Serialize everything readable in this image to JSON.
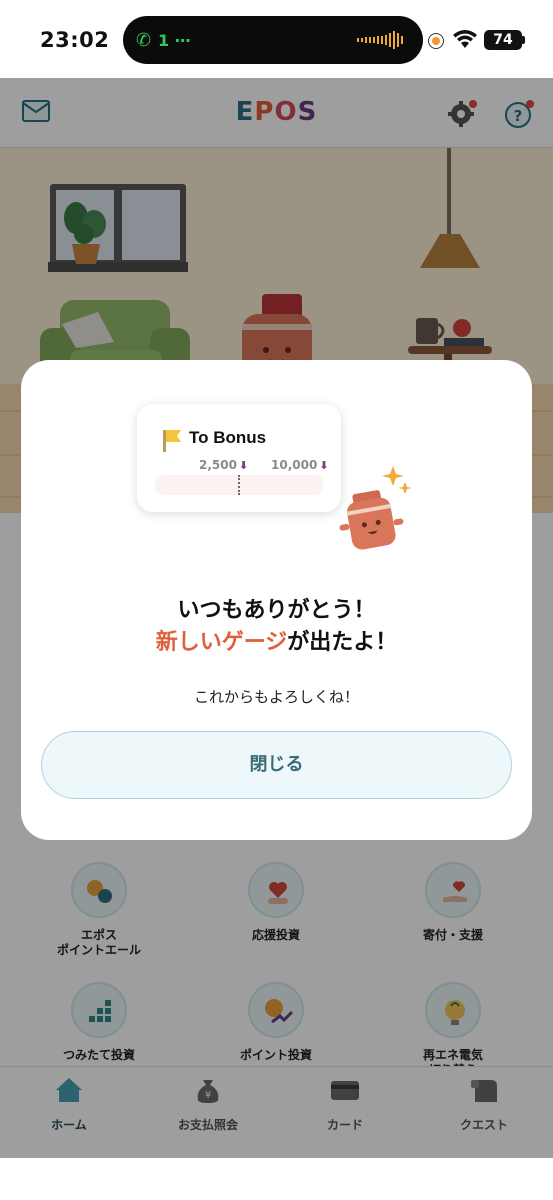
{
  "status_bar": {
    "time": "23:02",
    "call": "1 ⋯",
    "battery": "74"
  },
  "header": {
    "logo_letters": [
      {
        "char": "E",
        "color": "#2a6f86"
      },
      {
        "char": "P",
        "color": "#e0603a"
      },
      {
        "char": "O",
        "color": "#d14b5b"
      },
      {
        "char": "S",
        "color": "#6a3d7a"
      }
    ]
  },
  "features": [
    {
      "label": "エポス\nポイントエール"
    },
    {
      "label": "応援投資"
    },
    {
      "label": "寄付・支援"
    },
    {
      "label": "つみたて投資"
    },
    {
      "label": "ポイント投資"
    },
    {
      "label": "再エネ電気\n切り替え"
    }
  ],
  "nav": [
    {
      "label": "ホーム"
    },
    {
      "label": "お支払照会"
    },
    {
      "label": "カード"
    },
    {
      "label": "クエスト"
    }
  ],
  "modal": {
    "card_title": "To Bonus",
    "gauge_left": "2,500",
    "gauge_right": "10,000",
    "title_line1": "いつもありがとう！",
    "title_line2_accent": "新しいゲージ",
    "title_line2_rest": "が出たよ！",
    "subtitle": "これからもよろしくね！",
    "close_label": "閉じる"
  },
  "colors": {
    "accent": "#e0603a",
    "button_text": "#3b6b78",
    "button_border": "#a9d6de"
  }
}
